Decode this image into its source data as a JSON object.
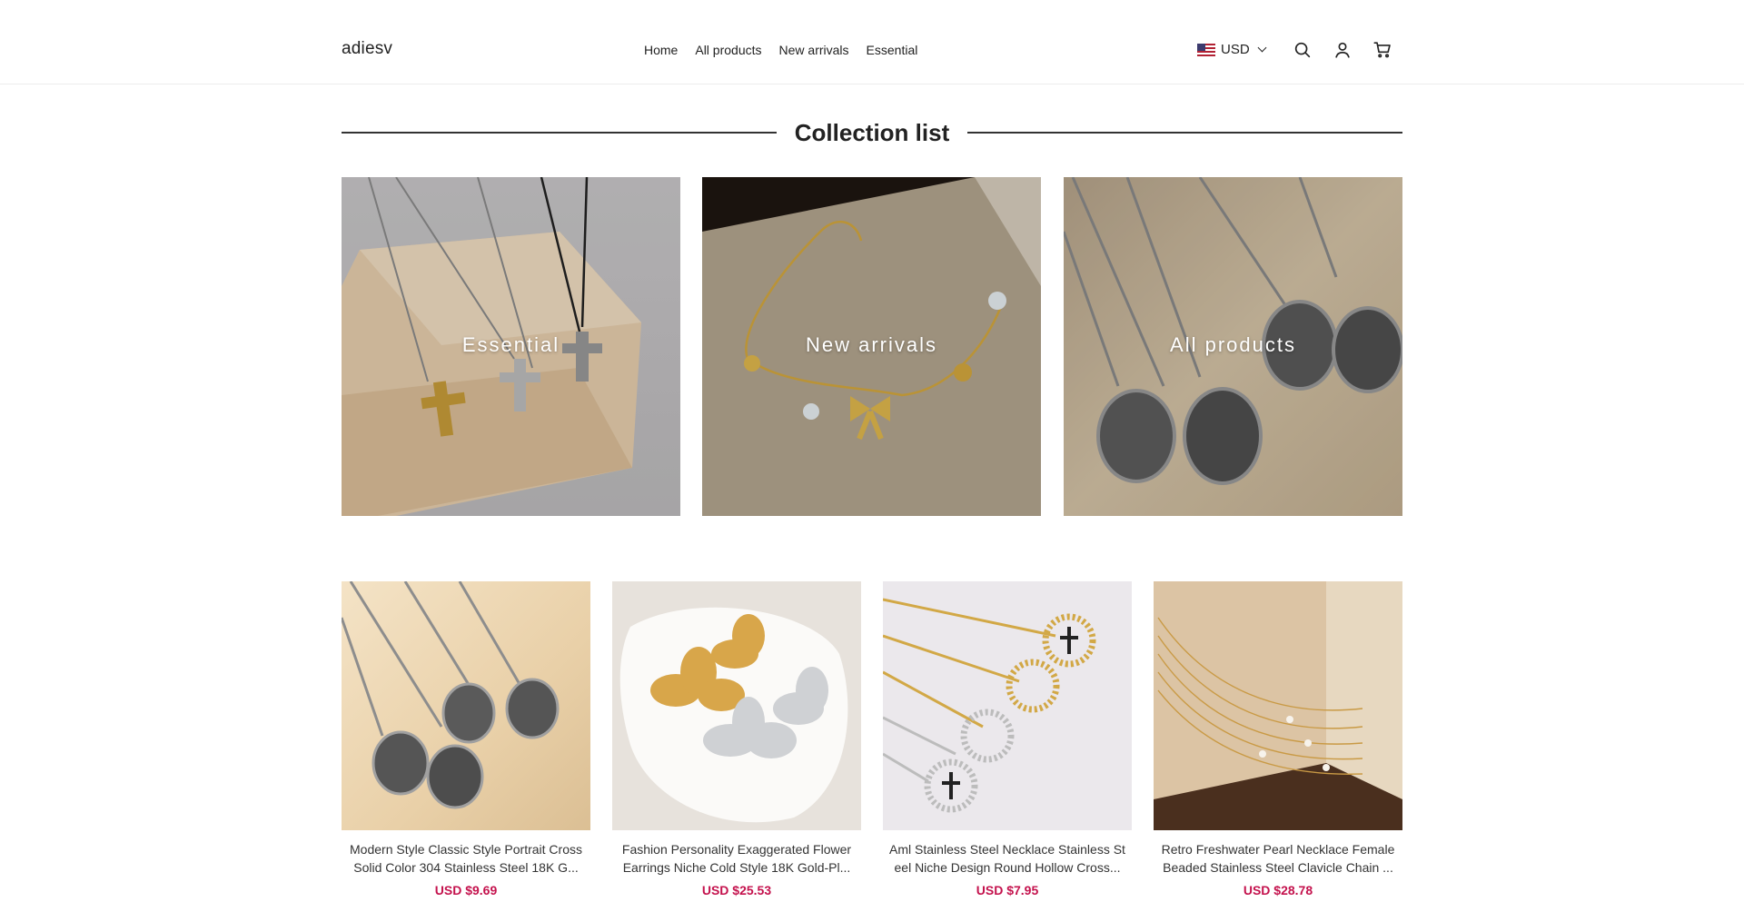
{
  "header": {
    "logo": "adiesv",
    "nav": [
      "Home",
      "All products",
      "New arrivals",
      "Essential"
    ],
    "currency": "USD",
    "icons": [
      "search-icon",
      "account-icon",
      "cart-icon"
    ]
  },
  "collection": {
    "title": "Collection list",
    "tiles": [
      {
        "label": "Essential"
      },
      {
        "label": "New arrivals"
      },
      {
        "label": "All products"
      }
    ]
  },
  "products": [
    {
      "name": "Modern Style Classic Style Portrait Cross Solid Color 304 Stainless Steel 18K G...",
      "price": "USD $9.69"
    },
    {
      "name": "Fashion Personality Exaggerated Flower Earrings Niche Cold Style 18K Gold-Pl...",
      "price": "USD $25.53"
    },
    {
      "name": "Aml Stainless Steel Necklace Stainless St eel Niche Design Round Hollow Cross...",
      "price": "USD $7.95"
    },
    {
      "name": "Retro Freshwater Pearl Necklace Female Beaded Stainless Steel Clavicle Chain ...",
      "price": "USD $28.78"
    }
  ],
  "colors": {
    "price": "#c4124d",
    "text": "#222222"
  }
}
